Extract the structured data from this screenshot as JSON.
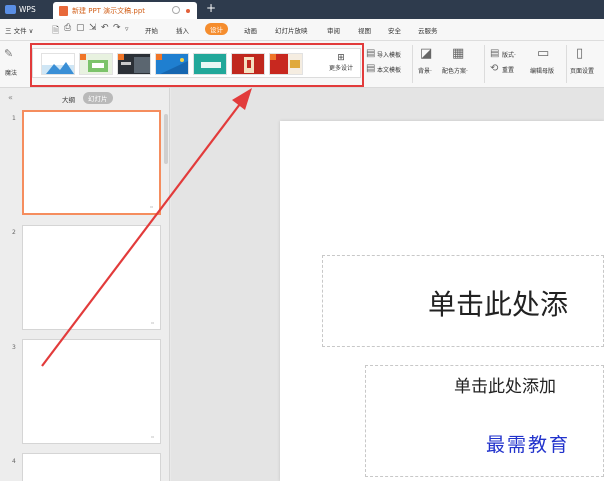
{
  "titlebar": {
    "app_label": "WPS",
    "doc_title": "新建 PPT 演示文稿.ppt",
    "new_tab": "+"
  },
  "menubar": {
    "file_label": "三 文件 ∨",
    "items": [
      "开始",
      "插入",
      "设计",
      "动画",
      "幻灯片放映",
      "审阅",
      "视图",
      "安全",
      "云服务"
    ],
    "active": "设计"
  },
  "ribbon": {
    "left_label": "魔法",
    "more_design_label": "更多设计",
    "import_template": "导入模板",
    "this_template": "本文模板",
    "background": "背景·",
    "color_scheme": "配色方案·",
    "layout": "版式·",
    "reset": "重置",
    "edit_master": "编辑母版",
    "page_setup": "页面设置"
  },
  "left_panel": {
    "tab_outline": "大纲",
    "tab_slides": "幻灯片",
    "slide_numbers": [
      "1",
      "2",
      "3",
      "4"
    ]
  },
  "slide": {
    "title_placeholder": "单击此处添",
    "subtitle_placeholder": "单击此处添加",
    "watermark": "最需教育"
  },
  "colors": {
    "accent": "#f58d2e",
    "titlebar": "#2e3b4d",
    "annotation": "#e23b3b"
  }
}
